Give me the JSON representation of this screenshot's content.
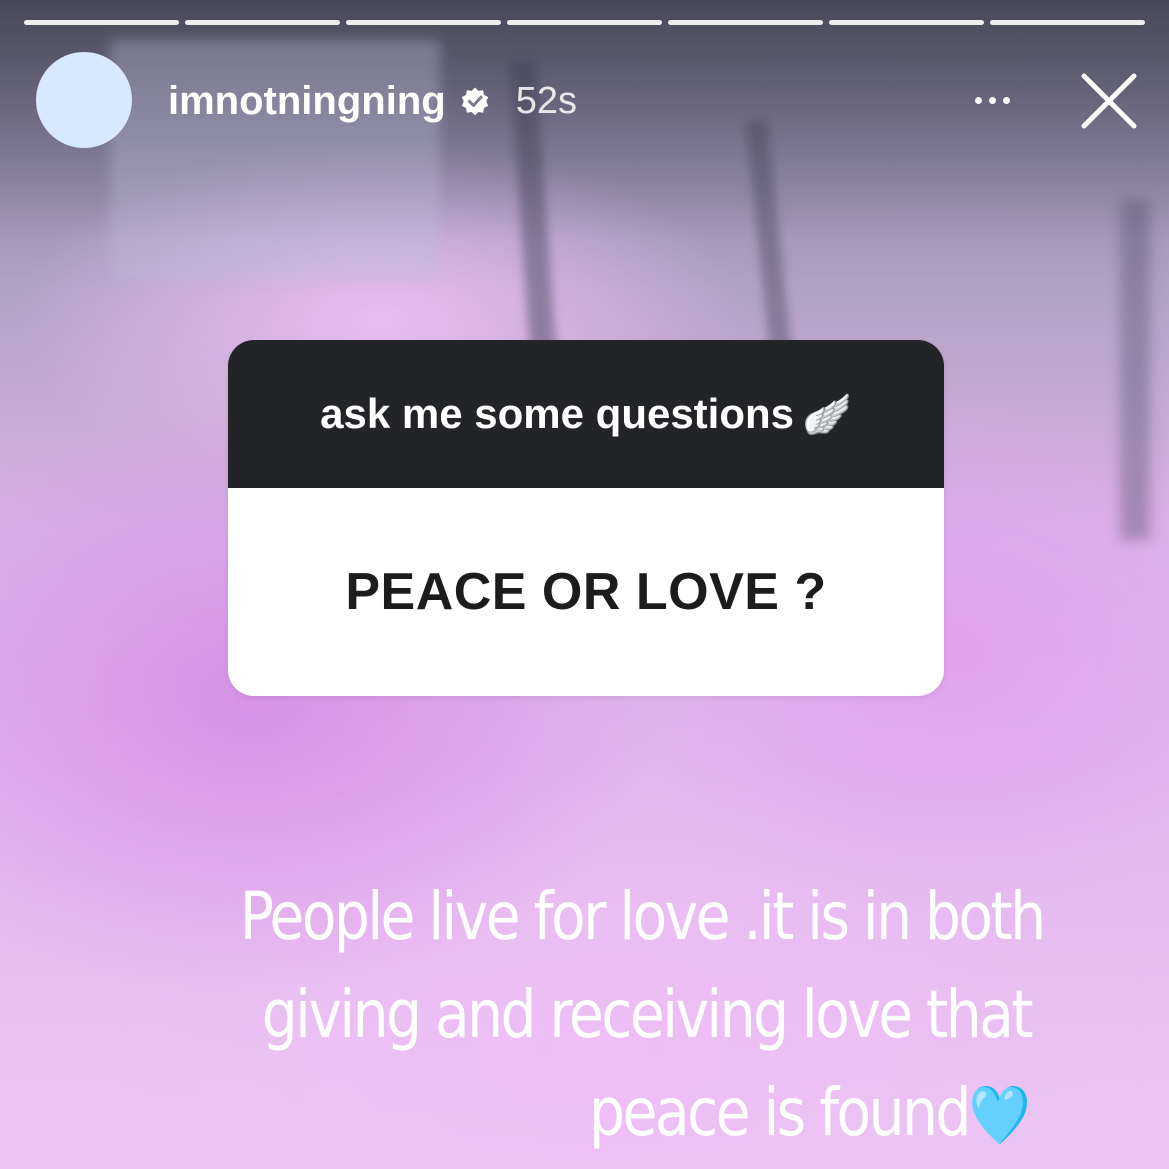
{
  "story": {
    "progress_segments": 7,
    "username": "imnotningning",
    "time": "52s",
    "verified_icon": "verified-badge-icon",
    "more_icon": "more-options-icon",
    "close_icon": "close-icon"
  },
  "question_sticker": {
    "prompt": "ask me some questions",
    "prompt_emoji": "🪽",
    "question": "PEACE OR LOVE ?"
  },
  "answer": {
    "line1": "People live for love .it is in both",
    "line2": "giving and receiving love that",
    "line3": "peace is found",
    "heart_emoji": "🩵"
  },
  "colors": {
    "sticker_header": "#232427",
    "sticker_body": "#ffffff",
    "avatar": "#d7e8ff"
  }
}
